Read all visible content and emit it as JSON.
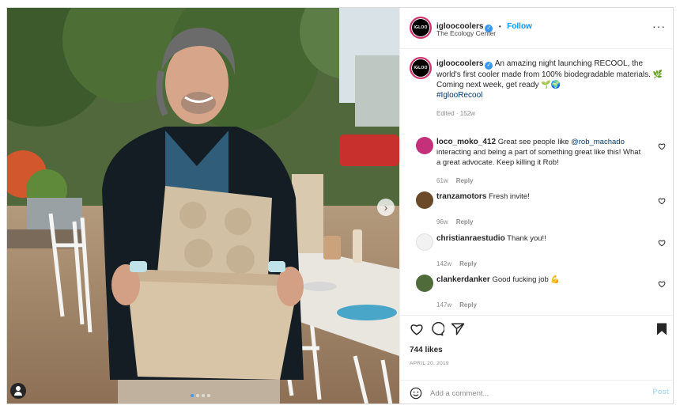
{
  "account": {
    "username": "igloocoolers",
    "avatar_text": "IGLOO",
    "verified": true,
    "follow_label": "Follow",
    "separator": "•",
    "location": "The Ecology Center",
    "more_icon": "more-horizontal-icon"
  },
  "caption": {
    "username": "igloocoolers",
    "body": "An amazing night launching RECOOL, the world's first cooler made from 100% biodegradable materials. 🌿 Coming next week, get ready 🌱🌍",
    "hashtag": "#IglooRecool",
    "edited": "Edited · 152w"
  },
  "comments": [
    {
      "username": "loco_moko_412",
      "before": "Great see people like ",
      "mention": "@rob_machado",
      "after": " interacting and being a part of something great like this! What a great advocate. Keep killing it Rob!",
      "age": "61w",
      "reply_label": "Reply",
      "avatar_color": "#c4307a"
    },
    {
      "username": "tranzamotors",
      "before": "Fresh invite!",
      "mention": "",
      "after": "",
      "age": "96w",
      "reply_label": "Reply",
      "avatar_color": "#6b4a2a"
    },
    {
      "username": "christianraestudio",
      "before": "Thank you!!",
      "mention": "",
      "after": "",
      "age": "142w",
      "reply_label": "Reply",
      "avatar_color": "#f2f2f2"
    },
    {
      "username": "clankerdanker",
      "before": "Good fucking job 💪",
      "mention": "",
      "after": "",
      "age": "147w",
      "reply_label": "Reply",
      "avatar_color": "#4f6b3a"
    }
  ],
  "actions": {
    "like_icon": "heart-icon",
    "comment_icon": "comment-icon",
    "share_icon": "send-icon",
    "save_icon": "bookmark-icon"
  },
  "likes": "744 likes",
  "date": "APRIL 20, 2019",
  "add_comment": {
    "placeholder": "Add a comment...",
    "post_label": "Post",
    "emoji_icon": "smiley-icon"
  },
  "photo": {
    "next_icon": "chevron-right-icon",
    "tag_icon": "user-tag-icon",
    "carousel_position": 1,
    "carousel_total": 4
  },
  "colors": {
    "link": "#0095f6",
    "hashtag": "#00376b",
    "muted": "#8e8e8e",
    "brand_ring": "#d22f6a"
  }
}
